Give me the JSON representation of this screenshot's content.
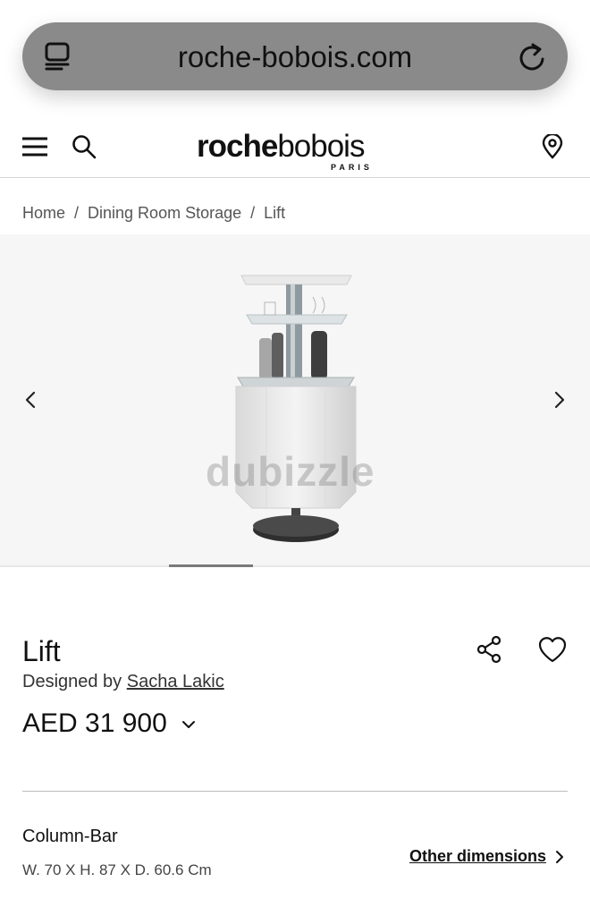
{
  "browser": {
    "url": "roche-bobois.com",
    "tabs_icon": "tabs-icon",
    "reload_icon": "reload-icon"
  },
  "header": {
    "logo_bold": "roche",
    "logo_light": "bobois",
    "logo_sub": "PARIS",
    "menu_icon": "hamburger-menu-icon",
    "search_icon": "search-icon",
    "location_icon": "map-pin-icon"
  },
  "breadcrumb": {
    "items": [
      "Home",
      "Dining Room Storage",
      "Lift"
    ],
    "separator": "/"
  },
  "gallery": {
    "watermark": "dubizzle",
    "image_count_position": "2",
    "prev_icon": "chevron-left-icon",
    "next_icon": "chevron-right-icon"
  },
  "product": {
    "title": "Lift",
    "designer_prefix": "Designed by",
    "designer_name": "Sacha Lakic",
    "price": "AED 31 900",
    "variant_name": "Column-Bar",
    "dimensions": "W. 70 X H. 87 X D. 60.6 Cm",
    "other_dimensions_label": "Other dimensions"
  },
  "colors": {
    "url_bar": "#8a8a8a",
    "text": "#111111",
    "gallery_bg": "#f6f6f6"
  }
}
